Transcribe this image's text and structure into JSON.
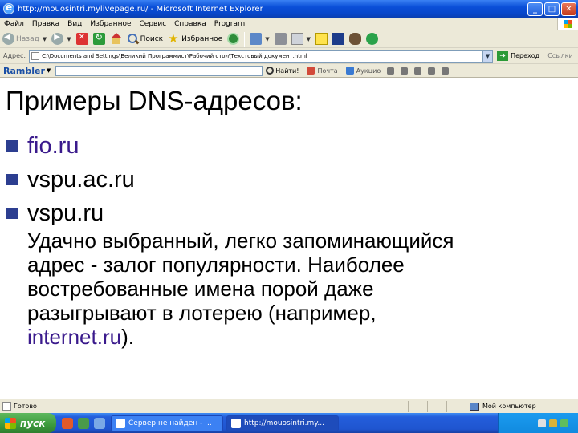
{
  "window": {
    "title": "http://mouosintri.mylivepage.ru/ - Microsoft Internet Explorer",
    "min_label": "_",
    "max_label": "□",
    "close_label": "✕"
  },
  "menu": [
    "Файл",
    "Правка",
    "Вид",
    "Избранное",
    "Сервис",
    "Справка",
    "Prograrn"
  ],
  "toolbar": {
    "back_label": "Назад",
    "search_label": "Поиск",
    "favorites_label": "Избранное"
  },
  "address": {
    "label": "Адрес:",
    "value": "C:\\Documents and Settings\\Великий Программист\\Рабочий стол\\Текстовый документ.html",
    "go_label": "Переход",
    "links_label": "Ссылки"
  },
  "rambler": {
    "logo": "Rambler",
    "find_label": "Найти!",
    "item1": "Почта",
    "item2": "Аукцио"
  },
  "content": {
    "title": "Примеры DNS-адресов:",
    "bullets": [
      {
        "text": "fio.ru",
        "is_link": true
      },
      {
        "text": "vspu.ac.ru",
        "is_link": true
      },
      {
        "text": "vspu.ru",
        "is_link": true
      }
    ],
    "paragraph_lines": [
      "Удачно выбранный, легко запоминающийся",
      "адрес - залог популярности. Наиболее",
      "востребованные имена порой даже",
      "разыгрывают в лотерею (например,"
    ],
    "paragraph_link": "internet.ru",
    "paragraph_tail": ")."
  },
  "status": {
    "text": "Готово",
    "zone": "Мой компьютер"
  },
  "taskbar": {
    "start_label": "пуск",
    "task1": "Сервер не найден - ...",
    "task2": "http://mouosintri.my...",
    "clock": ""
  },
  "colors": {
    "bullet_square": "#2c3e90",
    "link_text": "#3a1a8c",
    "titlebar_blue": "#0a4fd8"
  }
}
